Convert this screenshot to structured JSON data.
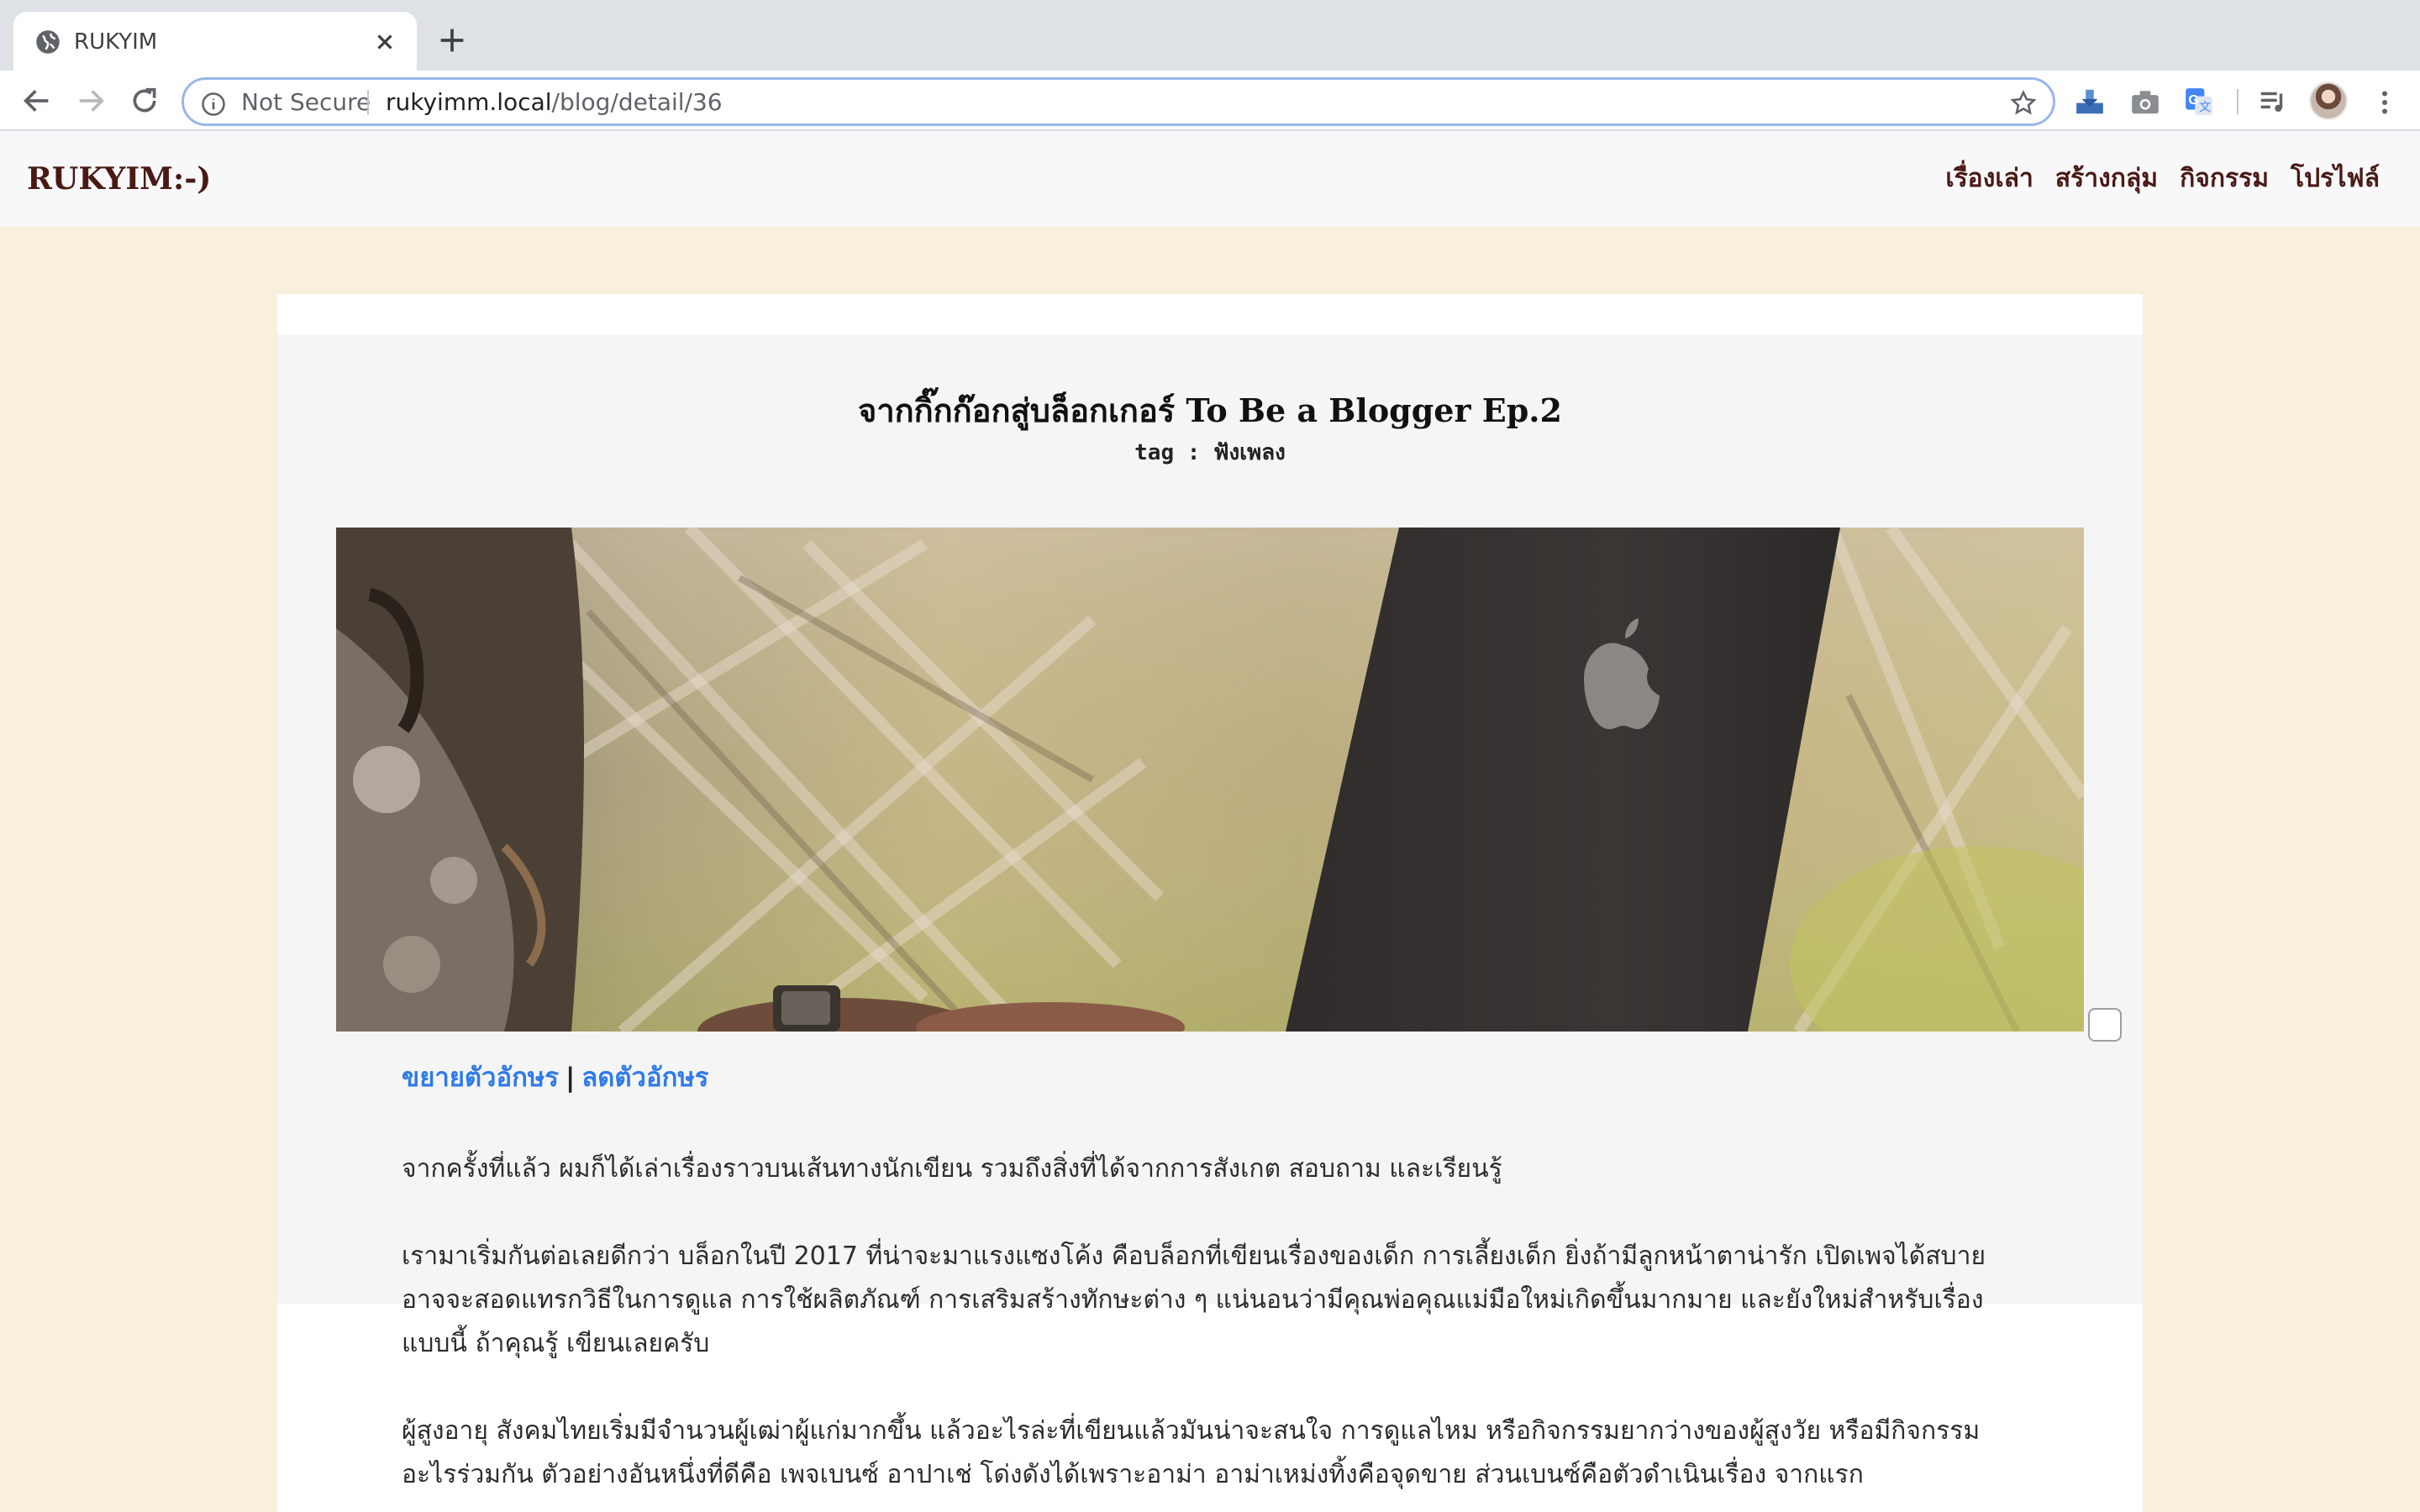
{
  "browser": {
    "tab_title": "RUKYIM",
    "security_label": "Not Secure",
    "url_host": "rukyimm.local",
    "url_path": "/blog/detail/36"
  },
  "site": {
    "brand": "RUKYIM:-)",
    "nav": [
      "เรื่องเล่า",
      "สร้างกลุ่ม",
      "กิจกรรม",
      "โปรไฟล์"
    ]
  },
  "post": {
    "title": "จากกิ๊กก๊อกสู่บล็อกเกอร์ To Be a Blogger Ep.2",
    "tag": "tag : ฟังเพลง",
    "font_increase": "ขยายตัวอักษร",
    "font_separator": "|",
    "font_decrease": "ลดตัวอักษร",
    "paragraphs": [
      "จากครั้งที่แล้ว ผมก็ได้เล่าเรื่องราวบนเส้นทางนักเขียน รวมถึงสิ่งที่ได้จากการสังเกต สอบถาม และเรียนรู้",
      "เรามาเริ่มกันต่อเลยดีกว่า บล็อกในปี 2017 ที่น่าจะมาแรงแซงโค้ง คือบล็อกที่เขียนเรื่องของเด็ก การเลี้ยงเด็ก ยิ่งถ้ามีลูกหน้าตาน่ารัก เปิดเพจได้สบาย อาจจะสอดแทรกวิธีในการดูแล การใช้ผลิตภัณฑ์ การเสริมสร้างทักษะต่าง ๆ แน่นอนว่ามีคุณพ่อคุณแม่มือใหม่เกิดขึ้นมากมาย และยังใหม่สำหรับเรื่องแบบนี้ ถ้าคุณรู้ เขียนเลยครับ",
      "ผู้สูงอายุ สังคมไทยเริ่มมีจำนวนผู้เฒ่าผู้แก่มากขึ้น แล้วอะไรล่ะที่เขียนแล้วมันน่าจะสนใจ การดูแลไหม หรือกิจกรรมยากว่างของผู้สูงวัย หรือมีกิจกรรมอะไรร่วมกัน ตัวอย่างอันหนึ่งที่ดีคือ เพจเบนซ์ อาปาเช่ โด่งดังได้เพราะอาม่า อาม่าเหม่งทิ้งคือจุดขาย ส่วนเบนซ์คือตัวดำเนินเรื่อง จากแรก"
    ]
  },
  "colors": {
    "page_bg": "#f8efdc",
    "brand": "#4a1914",
    "link": "#2f7be8"
  }
}
